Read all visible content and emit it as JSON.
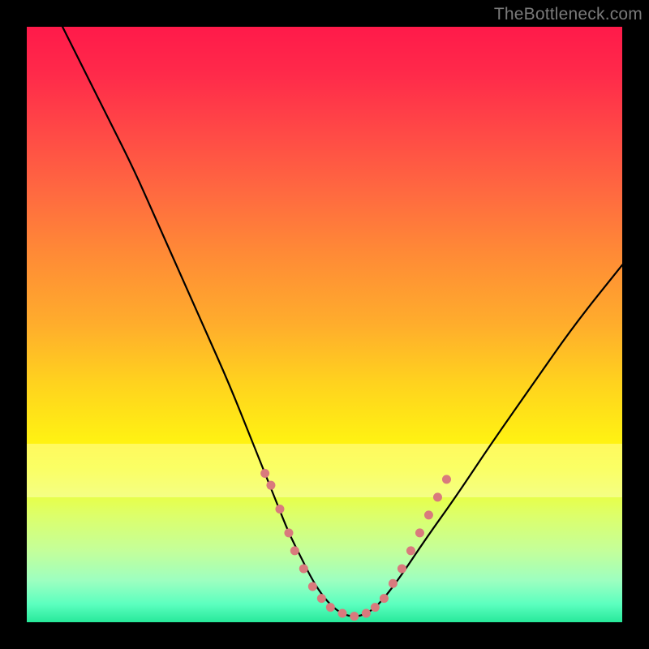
{
  "watermark": "TheBottleneck.com",
  "chart_data": {
    "type": "line",
    "title": "",
    "xlabel": "",
    "ylabel": "",
    "xlim": [
      0,
      100
    ],
    "ylim": [
      0,
      100
    ],
    "grid": false,
    "series": [
      {
        "name": "curve",
        "color": "#000000",
        "x": [
          6,
          10,
          14,
          18,
          22,
          26,
          30,
          34,
          38,
          40,
          42,
          44,
          46,
          48,
          50,
          52,
          54,
          56,
          58,
          60,
          63,
          67,
          72,
          78,
          85,
          92,
          100
        ],
        "y": [
          100,
          92,
          84,
          76,
          67,
          58,
          49,
          40,
          30,
          25,
          20,
          15,
          11,
          7,
          4,
          2,
          1,
          1,
          2,
          4,
          8,
          14,
          21,
          30,
          40,
          50,
          60
        ]
      }
    ],
    "markers": {
      "name": "dotted-segment",
      "color": "#d97a7d",
      "points": [
        {
          "x": 40,
          "y": 25
        },
        {
          "x": 41,
          "y": 23
        },
        {
          "x": 42.5,
          "y": 19
        },
        {
          "x": 44,
          "y": 15
        },
        {
          "x": 45,
          "y": 12
        },
        {
          "x": 46.5,
          "y": 9
        },
        {
          "x": 48,
          "y": 6
        },
        {
          "x": 49.5,
          "y": 4
        },
        {
          "x": 51,
          "y": 2.5
        },
        {
          "x": 53,
          "y": 1.5
        },
        {
          "x": 55,
          "y": 1
        },
        {
          "x": 57,
          "y": 1.5
        },
        {
          "x": 58.5,
          "y": 2.5
        },
        {
          "x": 60,
          "y": 4
        },
        {
          "x": 61.5,
          "y": 6.5
        },
        {
          "x": 63,
          "y": 9
        },
        {
          "x": 64.5,
          "y": 12
        },
        {
          "x": 66,
          "y": 15
        },
        {
          "x": 67.5,
          "y": 18
        },
        {
          "x": 69,
          "y": 21
        },
        {
          "x": 70.5,
          "y": 24
        }
      ]
    }
  }
}
